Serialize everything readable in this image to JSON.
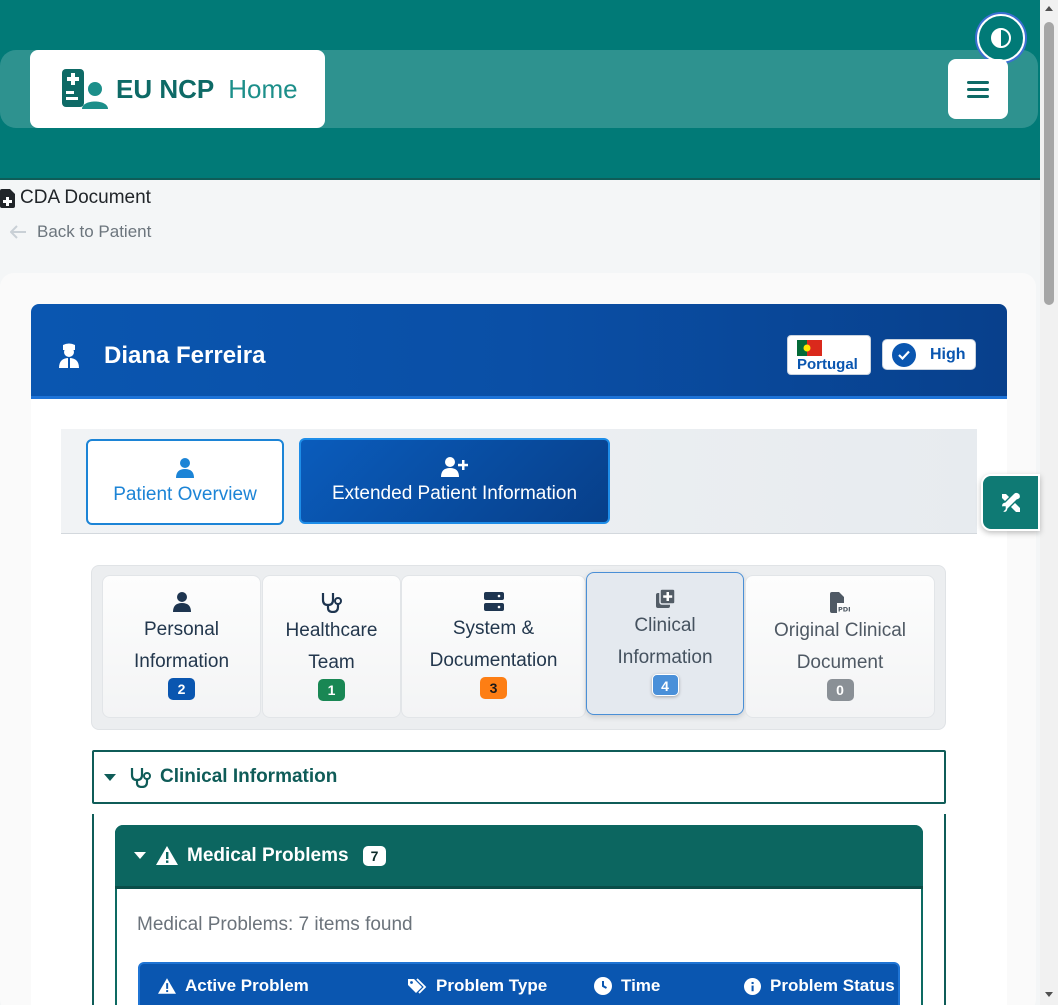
{
  "header": {
    "brand_name": "EU NCP",
    "brand_home": "Home",
    "logo_icon": "medical-staff-icon",
    "theme_toggle_icon": "contrast-icon",
    "menu_icon": "hamburger-icon",
    "colors": {
      "primary": "#017a77",
      "accent": "#0a56b0"
    }
  },
  "breadcrumb": {
    "doc_title": "CDA Document",
    "back_label": "Back to Patient"
  },
  "patient": {
    "name": "Diana Ferreira",
    "country": "Portugal",
    "assurance_level": "High"
  },
  "main_tabs": [
    {
      "label": "Patient Overview",
      "icon": "user-icon",
      "active": false
    },
    {
      "label": "Extended Patient Information",
      "icon": "user-plus-icon",
      "active": true
    }
  ],
  "sub_tabs": [
    {
      "line1": "Personal",
      "line2": "Information",
      "count": "2",
      "color": "#0a56b0",
      "icon": "user-icon"
    },
    {
      "line1": "Healthcare",
      "line2": "Team",
      "count": "1",
      "color": "#198754",
      "icon": "stethoscope-icon"
    },
    {
      "line1": "System &",
      "line2": "Documentation",
      "count": "3",
      "color": "#fd7e14",
      "icon": "server-icon"
    },
    {
      "line1": "Clinical",
      "line2": "Information",
      "count": "4",
      "color": "#4a90d9",
      "icon": "clinical-add-icon",
      "active": true
    },
    {
      "line1": "Original Clinical",
      "line2": "Document",
      "count": "0",
      "color": "#8a9096",
      "icon": "pdf-file-icon"
    }
  ],
  "clinical_section": {
    "title": "Clinical Information"
  },
  "medical_problems": {
    "title": "Medical Problems",
    "count": "7",
    "items_found": "Medical Problems: 7 items found",
    "columns": [
      "Active Problem",
      "Problem Type",
      "Time",
      "Problem Status"
    ]
  }
}
